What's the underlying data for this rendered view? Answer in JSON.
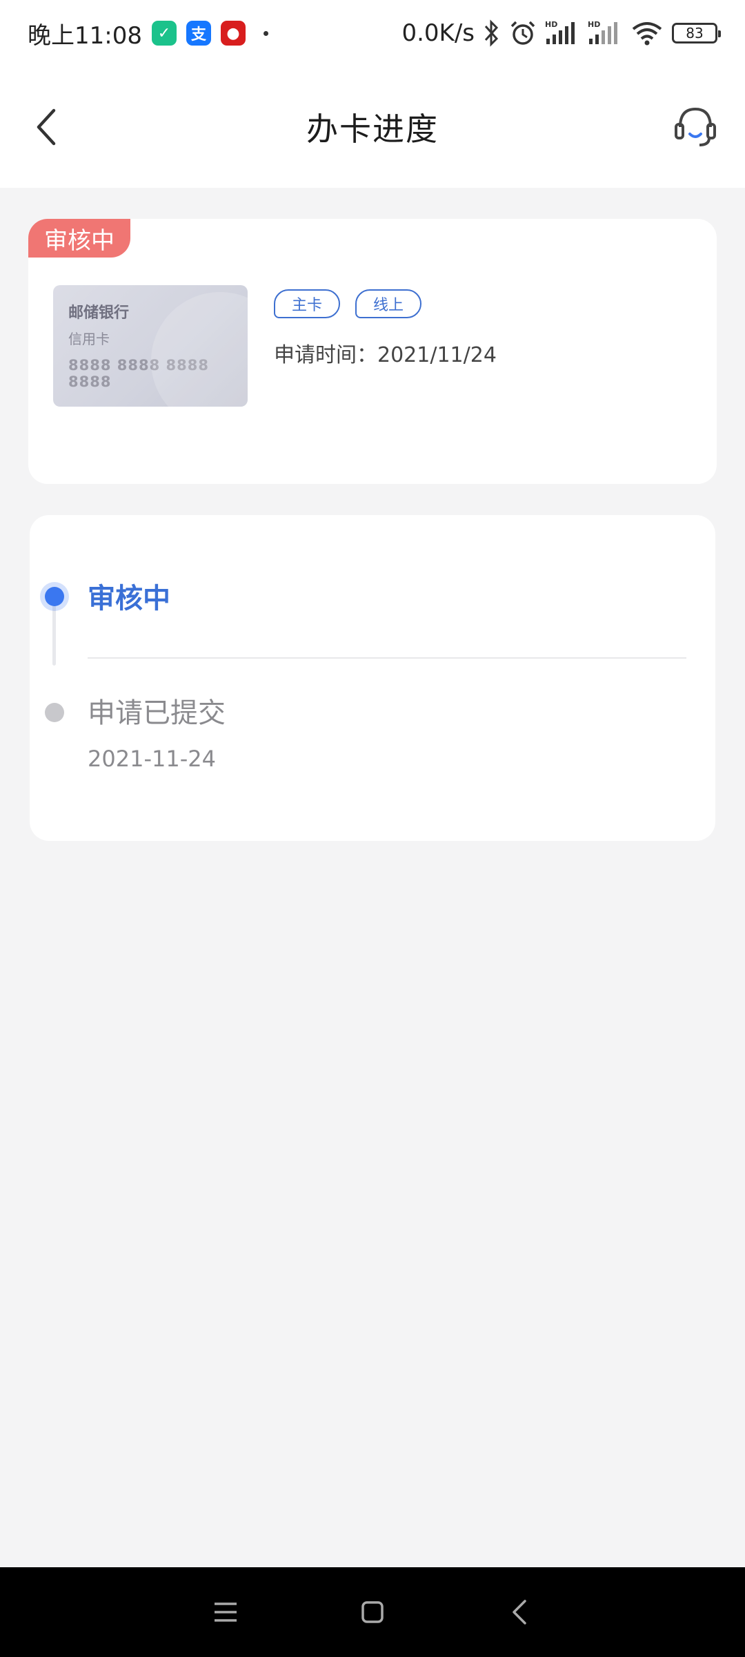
{
  "status_bar": {
    "time": "晚上11:08",
    "net_speed": "0.0K/s",
    "battery": "83",
    "app_icons": [
      "shield-app-icon",
      "alipay-icon",
      "record-app-icon"
    ]
  },
  "header": {
    "title": "办卡进度"
  },
  "card_summary": {
    "status_ribbon": "审核中",
    "card": {
      "bank_name": "邮储银行",
      "card_type": "信用卡",
      "card_number": "8888 8888 8888 8888"
    },
    "tags": [
      "主卡",
      "线上"
    ],
    "apply_time": "申请时间：2021/11/24"
  },
  "progress": {
    "steps": [
      {
        "label": "审核中",
        "status": "active"
      },
      {
        "label": "申请已提交",
        "date": "2021-11-24",
        "status": "done"
      }
    ]
  },
  "colors": {
    "accent": "#3a70d6",
    "ribbon": "#f07673",
    "background": "#f4f4f5"
  }
}
